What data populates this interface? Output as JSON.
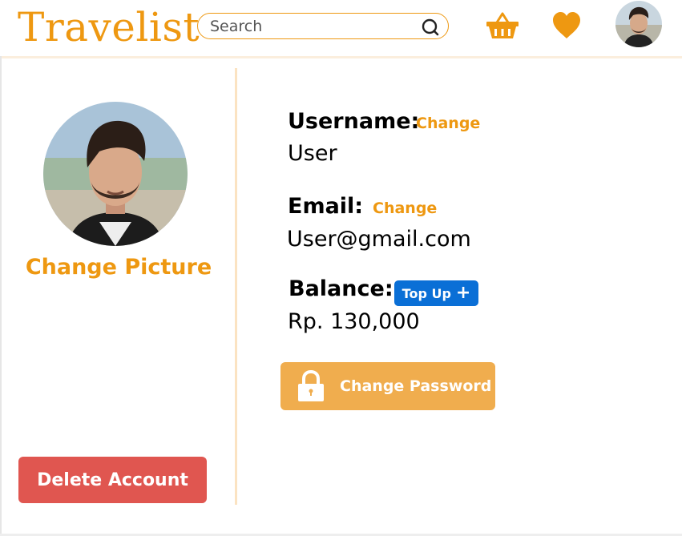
{
  "header": {
    "logo": "Travelist",
    "search": {
      "placeholder": "Search",
      "value": ""
    },
    "icons": [
      "search-icon",
      "basket-icon",
      "heart-icon",
      "avatar"
    ]
  },
  "sidebar": {
    "change_picture": "Change Picture",
    "delete_account": "Delete Account"
  },
  "profile": {
    "username_label": "Username:",
    "username_value": "User",
    "email_label": "Email:",
    "email_value": "User@gmail.com",
    "change_label": "Change",
    "balance_label": "Balance:",
    "balance_value": "Rp. 130,000",
    "top_up_label": "Top Up",
    "change_password_label": "Change Password"
  },
  "colors": {
    "accent": "#ee9811",
    "danger": "#e05650",
    "primary": "#0a6fd6",
    "warning": "#f0ad4e"
  }
}
